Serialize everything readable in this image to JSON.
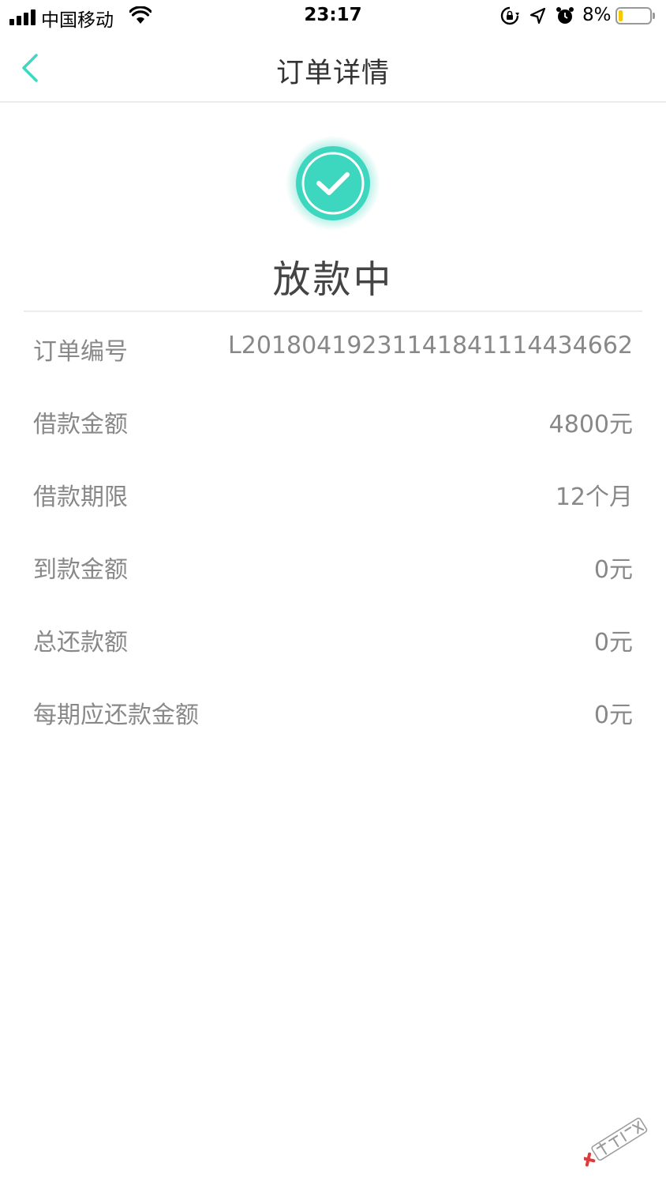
{
  "status_bar": {
    "carrier": "中国移动",
    "time": "23:17",
    "battery_percent": "8%"
  },
  "nav": {
    "title": "订单详情"
  },
  "status": {
    "text": "放款中",
    "accent_color": "#3fd7c0"
  },
  "details": [
    {
      "label": "订单编号",
      "value": "L20180419231141841114434662"
    },
    {
      "label": "借款金额",
      "value": "4800元"
    },
    {
      "label": "借款期限",
      "value": "12个月"
    },
    {
      "label": "到款金额",
      "value": "0元"
    },
    {
      "label": "总还款额",
      "value": "0元"
    },
    {
      "label": "每期应还款金额",
      "value": "0元"
    }
  ],
  "watermark": {
    "text": "卡农社区"
  }
}
